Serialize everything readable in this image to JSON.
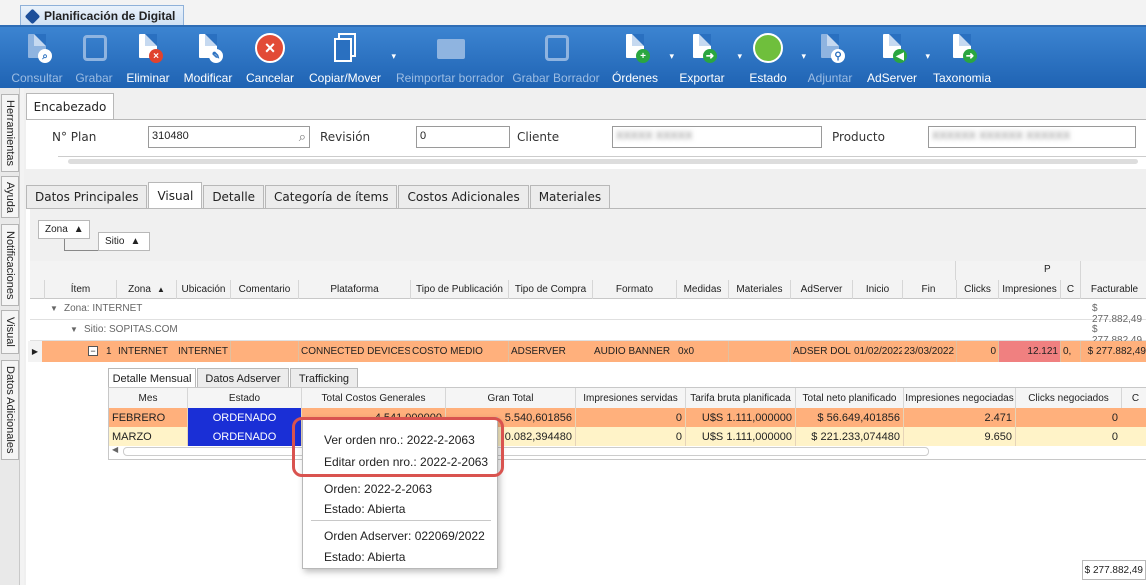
{
  "window": {
    "title": "Planificación de Digital"
  },
  "toolbar": {
    "buttons": [
      {
        "label": "Consultar",
        "icon": "doc-search-icon",
        "enabled": false
      },
      {
        "label": "Grabar",
        "icon": "save-icon",
        "enabled": false
      },
      {
        "label": "Eliminar",
        "icon": "doc-delete-icon",
        "enabled": true
      },
      {
        "label": "Modificar",
        "icon": "doc-edit-icon",
        "enabled": true
      },
      {
        "label": "Cancelar",
        "icon": "cancel-icon",
        "enabled": true
      },
      {
        "label": "Copiar/Mover",
        "icon": "copy-icon",
        "enabled": true,
        "dropdown": true
      },
      {
        "label": "Reimportar borrador",
        "icon": "folder-icon",
        "enabled": false
      },
      {
        "label": "Grabar Borrador",
        "icon": "save-draft-icon",
        "enabled": false
      },
      {
        "label": "Órdenes",
        "icon": "doc-add-icon",
        "enabled": true,
        "dropdown": true
      },
      {
        "label": "Exportar",
        "icon": "doc-export-icon",
        "enabled": true,
        "dropdown": true
      },
      {
        "label": "Estado",
        "icon": "status-icon",
        "enabled": true,
        "dropdown": true
      },
      {
        "label": "Adjuntar",
        "icon": "attach-icon",
        "enabled": false
      },
      {
        "label": "AdServer",
        "icon": "adserver-icon",
        "enabled": true,
        "dropdown": true
      },
      {
        "label": "Taxonomia",
        "icon": "taxonomy-icon",
        "enabled": true
      }
    ]
  },
  "side_tabs": [
    "Herramientas",
    "Ayuda",
    "Notificaciones",
    "Visual",
    "Datos Adicionales"
  ],
  "header": {
    "tab": "Encabezado",
    "plan_label": "N° Plan",
    "plan_value": "310480",
    "revision_label": "Revisión",
    "revision_value": "0",
    "cliente_label": "Cliente",
    "cliente_value": "XXXXX XXXXX",
    "producto_label": "Producto",
    "producto_value": "XXXXXX XXXXXX XXXXXX"
  },
  "tabs": [
    "Datos Principales",
    "Visual",
    "Detalle",
    "Categoría de ítems",
    "Costos Adicionales",
    "Materiales"
  ],
  "active_tab": "Visual",
  "group_by": {
    "zona": "Zona",
    "sitio": "Sitio"
  },
  "grid": {
    "columns": [
      "Ítem",
      "Zona",
      "Ubicación",
      "Comentario",
      "Plataforma",
      "Tipo de Publicación",
      "Tipo de Compra",
      "Formato",
      "Medidas",
      "Materiales",
      "AdServer",
      "Inicio",
      "Fin",
      "Clicks",
      "Impresiones",
      "C",
      "Facturable"
    ],
    "top_label": "P",
    "group_zona": "Zona: INTERNET",
    "group_zona_total": "$ 277.882,49",
    "group_sitio": "Sitio: SOPITAS.COM",
    "group_sitio_total": "$ 277.882,49",
    "row": {
      "item": "1",
      "zona": "INTERNET",
      "ubicacion": "INTERNET",
      "comentario": "",
      "plataforma": "CONNECTED DEVICES",
      "tipo_pub": "COSTO MEDIO",
      "tipo_compra": "ADSERVER",
      "formato": "AUDIO BANNER",
      "medidas": "0x0",
      "materiales": "",
      "adserver": "ADSER DOL",
      "inicio": "01/02/2022",
      "fin": "23/03/2022",
      "clicks": "0",
      "impresiones": "12.121",
      "c": "0,",
      "facturable": "$ 277.882,49"
    }
  },
  "detail": {
    "tabs": [
      "Detalle Mensual",
      "Datos Adserver",
      "Trafficking"
    ],
    "columns": [
      "Mes",
      "Estado",
      "Total Costos Generales",
      "Gran Total",
      "Impresiones servidas",
      "Tarifa bruta planificada",
      "Total neto planificado",
      "Impresiones negociadas",
      "Clicks negociados",
      "C"
    ],
    "rows": [
      {
        "mes": "FEBRERO",
        "estado": "ORDENADO",
        "total_costos": "4.541,000000",
        "gran_total": "5.540,601856",
        "imp_servidas": "0",
        "tarifa": "U$S 1.111,000000",
        "total_neto": "$ 56.649,401856",
        "imp_neg": "2.471",
        "clicks_neg": "0"
      },
      {
        "mes": "MARZO",
        "estado": "ORDENADO",
        "total_costos": "",
        "gran_total": "0.082,394480",
        "imp_servidas": "0",
        "tarifa": "U$S 1.111,000000",
        "total_neto": "$ 221.233,074480",
        "imp_neg": "9.650",
        "clicks_neg": "0"
      }
    ]
  },
  "context_menu": {
    "items": [
      "Ver orden nro.: 2022-2-2063",
      "Editar orden nro.: 2022-2-2063",
      "Orden: 2022-2-2063",
      "Estado: Abierta",
      "Orden Adserver: 022069/2022",
      "Estado: Abierta"
    ]
  },
  "footer": {
    "total": "$ 277.882,49"
  },
  "colors": {
    "toolbar": "#2a70c0",
    "row_highlight": "#ffb07c",
    "ordenado": "#1a2fd6",
    "impresiones_red": "#f08080",
    "callout": "#d9534f"
  }
}
